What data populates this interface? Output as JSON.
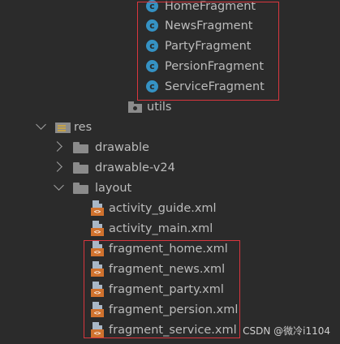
{
  "tree": {
    "classes": [
      "HomeFragment",
      "NewsFragment",
      "PartyFragment",
      "PersionFragment",
      "ServiceFragment"
    ],
    "class_icon_glyph": "c",
    "utils": "utils",
    "res": "res",
    "res_children": [
      "drawable",
      "drawable-v24"
    ],
    "layout": "layout",
    "layout_files": [
      "activity_guide.xml",
      "activity_main.xml"
    ],
    "fragment_files": [
      "fragment_home.xml",
      "fragment_news.xml",
      "fragment_party.xml",
      "fragment_persion.xml",
      "fragment_service.xml"
    ],
    "xml_badge": "<>"
  },
  "watermark": "CSDN @微冷i1104",
  "colors": {
    "background": "#2b2b2b",
    "highlight_border": "#d9363e",
    "class_icon": "#3592c4",
    "xml_badge": "#d0722e"
  }
}
